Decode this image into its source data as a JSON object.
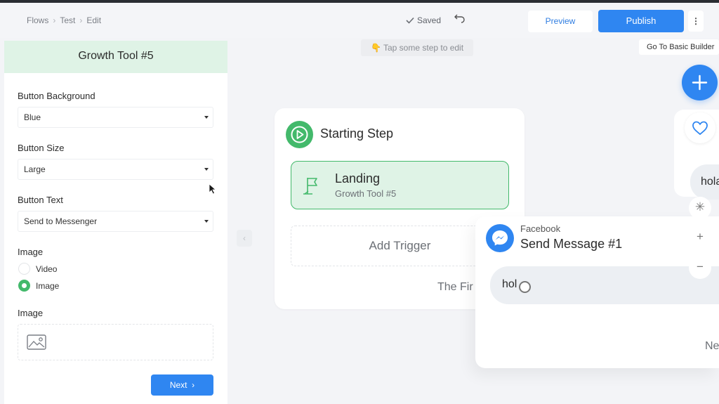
{
  "header": {
    "breadcrumb": [
      "Flows",
      "Test",
      "Edit"
    ],
    "saved_label": "Saved",
    "preview_label": "Preview",
    "publish_label": "Publish",
    "more_label": "⋮"
  },
  "sidebar": {
    "title": "Growth Tool #5",
    "fields": {
      "button_background": {
        "label": "Button Background",
        "value": "Blue"
      },
      "button_size": {
        "label": "Button Size",
        "value": "Large"
      },
      "button_text": {
        "label": "Button Text",
        "value": "Send to Messenger"
      }
    },
    "media": {
      "label": "Image",
      "options": [
        {
          "label": "Video",
          "selected": false
        },
        {
          "label": "Image",
          "selected": true
        }
      ]
    },
    "image_upload_label": "Image",
    "next_label": "Next"
  },
  "canvas": {
    "hint": "👇 Tap some step to edit",
    "basic_builder_label": "Go To Basic Builder",
    "starting_step": {
      "title": "Starting Step",
      "trigger": {
        "title": "Landing",
        "subtitle": "Growth Tool #5"
      },
      "add_trigger_label": "Add Trigger",
      "next_text": "The Fir"
    },
    "message_step": {
      "platform": "Facebook",
      "title": "Send Message #1",
      "message_text": "hol",
      "next_text": "Ne"
    },
    "side_bubble_text": "hola"
  },
  "colors": {
    "accent_blue": "#2f86f1",
    "accent_green": "#43b96b",
    "success_tint": "#dff3e6"
  },
  "icons": [
    "chevron-right-icon",
    "check-icon",
    "undo-icon",
    "caret-down-icon",
    "image-icon",
    "play-icon",
    "flag-icon",
    "messenger-icon",
    "plus-icon",
    "heart-icon",
    "sparkle-icon",
    "minus-icon",
    "chevron-left-icon",
    "mouse-cursor-icon"
  ]
}
